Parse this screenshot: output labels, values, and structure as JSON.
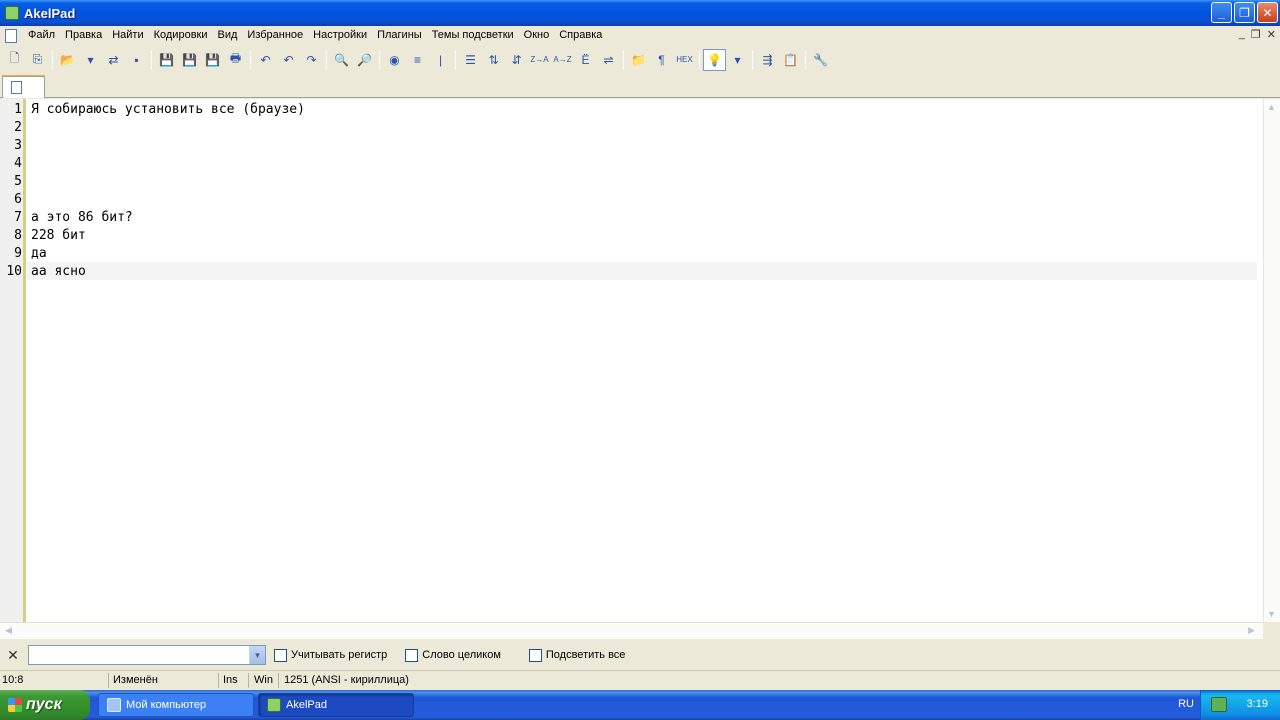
{
  "window": {
    "title": "AkelPad"
  },
  "menu": [
    "Файл",
    "Правка",
    "Найти",
    "Кодировки",
    "Вид",
    "Избранное",
    "Настройки",
    "Плагины",
    "Темы подсветки",
    "Окно",
    "Справка"
  ],
  "mdi_buttons": [
    "_",
    "❐",
    "✕"
  ],
  "toolbar": {
    "buttons": [
      {
        "name": "new-file-icon",
        "glyph": "🗋"
      },
      {
        "name": "copy-icon",
        "glyph": "⎘"
      },
      {
        "name": "open-folder-icon",
        "glyph": "📂"
      },
      {
        "name": "open-dropdown-icon",
        "glyph": "▾"
      },
      {
        "name": "reopen-icon",
        "glyph": "⇄"
      },
      {
        "name": "close-doc-icon",
        "glyph": "▪"
      },
      {
        "name": "save-icon",
        "glyph": "💾"
      },
      {
        "name": "save-as-icon",
        "glyph": "💾"
      },
      {
        "name": "save-all-icon",
        "glyph": "💾"
      },
      {
        "name": "print-icon",
        "glyph": "🖶"
      },
      {
        "name": "undo-all-icon",
        "glyph": "↶"
      },
      {
        "name": "undo-icon",
        "glyph": "↶"
      },
      {
        "name": "redo-icon",
        "glyph": "↷"
      },
      {
        "name": "find-icon",
        "glyph": "🔍"
      },
      {
        "name": "replace-icon",
        "glyph": "🔎"
      },
      {
        "name": "goto-icon",
        "glyph": "◉"
      },
      {
        "name": "insert-date-icon",
        "glyph": "≡"
      },
      {
        "name": "marker-icon",
        "glyph": "|"
      },
      {
        "name": "list-icon",
        "glyph": "☰"
      },
      {
        "name": "sort-asc-icon",
        "glyph": "⇅"
      },
      {
        "name": "sort-desc-icon",
        "glyph": "⇵"
      },
      {
        "name": "za-icon",
        "glyph": "Z→A"
      },
      {
        "name": "az-icon",
        "glyph": "A→Z"
      },
      {
        "name": "case-icon",
        "glyph": "Ё"
      },
      {
        "name": "convert-icon",
        "glyph": "⇌"
      },
      {
        "name": "folder-icon",
        "glyph": "📁"
      },
      {
        "name": "pilcrow-icon",
        "glyph": "¶"
      },
      {
        "name": "hex-icon",
        "glyph": "HEX"
      },
      {
        "name": "bulb-icon",
        "glyph": "💡"
      },
      {
        "name": "bulb-dropdown-icon",
        "glyph": "▾"
      },
      {
        "name": "split-icon",
        "glyph": "⇶"
      },
      {
        "name": "clipboard-icon",
        "glyph": "📋"
      },
      {
        "name": "settings-icon",
        "glyph": "🔧"
      }
    ]
  },
  "editor": {
    "lines": [
      {
        "num": "1",
        "text": "Я собираюсь установить все (браузе)"
      },
      {
        "num": "2",
        "text": ""
      },
      {
        "num": "3",
        "text": ""
      },
      {
        "num": "4",
        "text": ""
      },
      {
        "num": "5",
        "text": ""
      },
      {
        "num": "6",
        "text": ""
      },
      {
        "num": "7",
        "text": "а это 86 бит?"
      },
      {
        "num": "8",
        "text": "228 бит"
      },
      {
        "num": "9",
        "text": "да"
      },
      {
        "num": "10",
        "text": "аа ясно"
      }
    ]
  },
  "find": {
    "close": "✕",
    "match_case": "Учитывать регистр",
    "whole_word": "Слово целиком",
    "highlight_all": "Подсветить все"
  },
  "status": {
    "position": "10:8",
    "modified": "Изменён",
    "insert_mode": "Ins",
    "newline": "Win",
    "encoding": "1251  (ANSI - кириллица)"
  },
  "taskbar": {
    "start": "пуск",
    "tasks": [
      "Мой компьютер",
      "AkelPad"
    ],
    "lang": "RU",
    "clock": "3:19"
  }
}
